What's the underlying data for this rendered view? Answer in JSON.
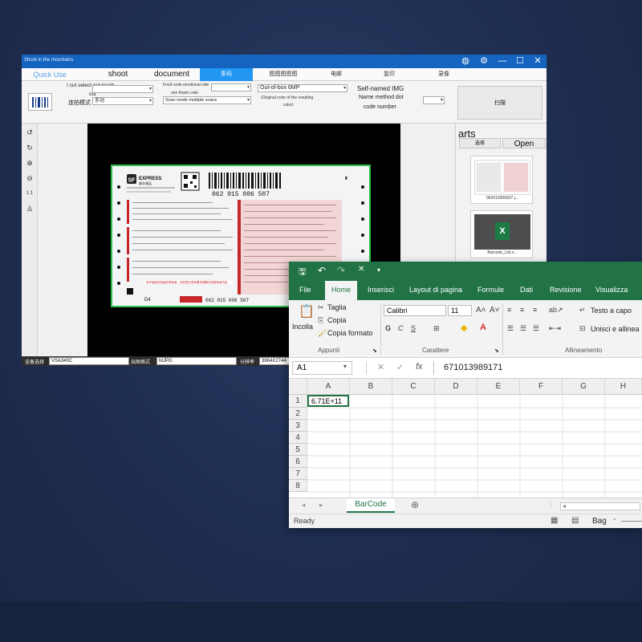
{
  "scanner_app": {
    "title": "Shoot in the mountains",
    "tabs": [
      "Quick Use",
      "shoot",
      "document",
      "条码",
      "图图图图图",
      "电邮",
      "复印",
      "录像"
    ],
    "toolbar": {
      "cut_option": "I cut select not teach",
      "cut": "cut",
      "shoot_mode_label": "连拍模式",
      "shoot_mode_value": "手动",
      "food_code": "Food code emotional side",
      "one_thank_code": "one thank code",
      "scan_mode": "Scan mode multiple scans",
      "out_of_box": "Out-of-box 6MP",
      "original_color_1": "(Original color of the resulting",
      "original_color_2": "color)",
      "self_named": "Self-named IMG",
      "name_method": "Name method dot",
      "code_number": "code number",
      "scan_button": "扫描"
    },
    "left_tools": [
      "↺",
      "↻",
      "⊕",
      "⊖",
      "1:1",
      "♙"
    ],
    "waybill": {
      "brand": "EXPRESS",
      "brand_cn": "顺丰速运",
      "barcode_number": "062 015 006 507",
      "bottom_number": "062 015 006 507",
      "d4": "D4",
      "red_notice": "请仔细阅读背面托寄条款，您的签名意味着您理解并接受条款内容"
    },
    "right_panel": {
      "title": "arts",
      "tab_select": "选择",
      "tab_open": "Open",
      "thumb1_caption": "062015006507.j...",
      "thumb2_caption": "Barcode_List.x..."
    },
    "statusbar": {
      "device_label": "设备选择",
      "device_value": "VSA340C",
      "output_label": "出图格式",
      "output_value": "MJPG",
      "resolution_label": "分辨率",
      "resolution_value": "3664X2744"
    }
  },
  "excel": {
    "tabs": [
      "File",
      "Home",
      "Inserisci",
      "Layout di pagina",
      "Formule",
      "Dati",
      "Revisione",
      "Visualizza"
    ],
    "ribbon": {
      "paste": "Incolla",
      "cut": "Taglia",
      "copy": "Copia",
      "format_painter": "Copia formato",
      "group_clipboard": "Appunti",
      "font_name": "Calibri",
      "font_size": "11",
      "group_font": "Carattere",
      "wrap_text": "Testo a capo",
      "merge": "Unisci e allinea",
      "group_alignment": "Allineamento"
    },
    "name_box": "A1",
    "formula": "671013989171",
    "columns": [
      "A",
      "B",
      "C",
      "D",
      "E",
      "F",
      "G",
      "H"
    ],
    "rows": [
      "1",
      "2",
      "3",
      "4",
      "5",
      "6",
      "7",
      "8"
    ],
    "cell_a1": "6.71E+11",
    "sheet_tab": "BarCode",
    "status_ready": "Ready",
    "status_page": "Bag"
  },
  "colors": {
    "excel_green": "#217346",
    "scanner_blue": "#2196f3",
    "background": "#1e2d50"
  }
}
